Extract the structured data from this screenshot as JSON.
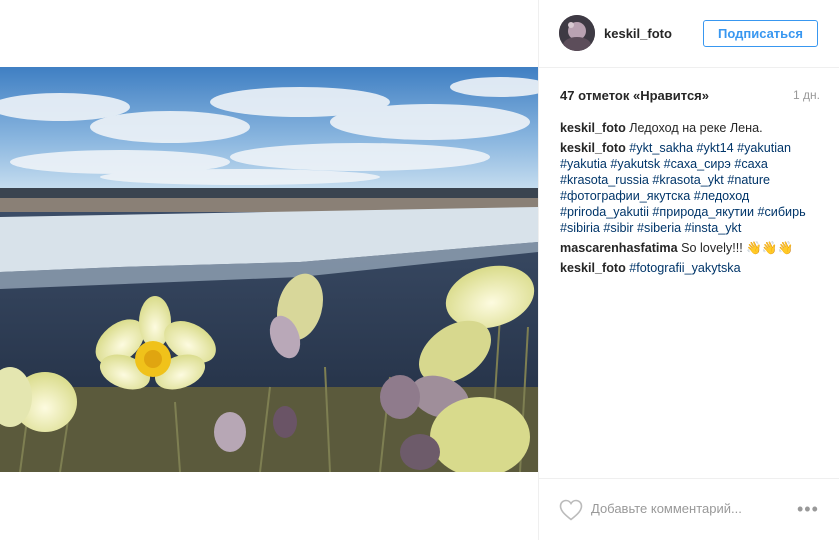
{
  "header": {
    "username": "keskil_foto",
    "follow_label": "Подписаться"
  },
  "stats": {
    "likes_label": "47 отметок «Нравится»",
    "time_label": "1 дн."
  },
  "comments": [
    {
      "user": "keskil_foto",
      "text": "Ледоход на реке Лена.",
      "tags": []
    },
    {
      "user": "keskil_foto",
      "text": "",
      "tags": [
        "#ykt_sakha",
        "#ykt14",
        "#yakutian",
        "#yakutia",
        "#yakutsk",
        "#саха_сирэ",
        "#саха",
        "#krasota_russia",
        "#krasota_ykt",
        "#nature",
        "#фотографии_якутска",
        "#ледоход",
        "#priroda_yakutii",
        "#природа_якутии",
        "#сибирь",
        "#sibiria",
        "#sibir",
        "#siberia",
        "#insta_ykt"
      ]
    },
    {
      "user": "mascarenhasfatima",
      "text": "So lovely!!! 👋👋👋",
      "tags": []
    },
    {
      "user": "keskil_foto",
      "text": "",
      "tags": [
        "#fotografii_yakytska"
      ]
    }
  ],
  "footer": {
    "comment_placeholder": "Добавьте комментарий...",
    "more_label": "•••",
    "heart_icon": "heart-outline-icon"
  },
  "colors": {
    "link": "#003569",
    "follow": "#3897f0",
    "muted": "#999999"
  }
}
